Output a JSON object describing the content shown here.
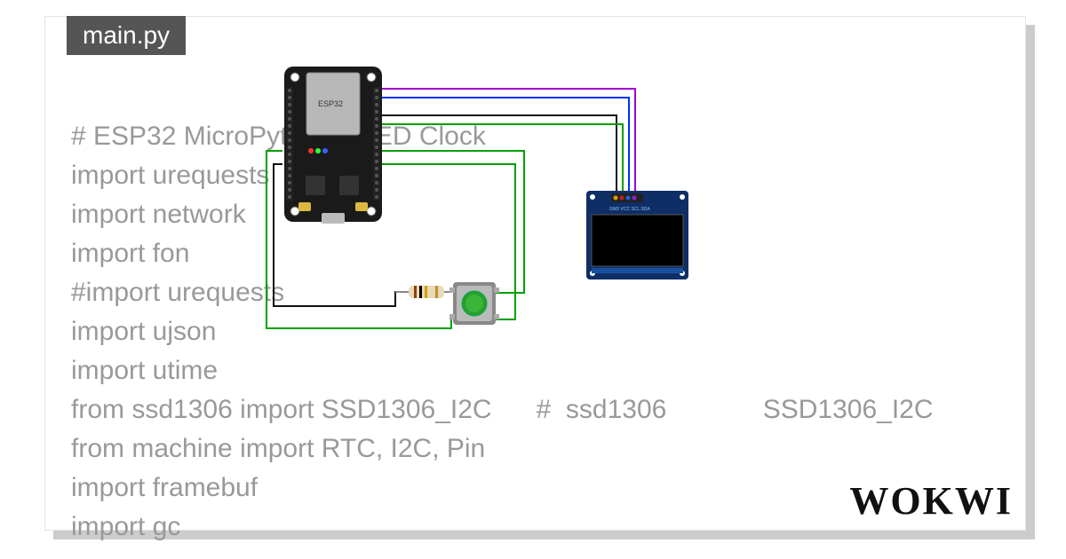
{
  "tab": {
    "title": "main.py"
  },
  "code": {
    "lines": [
      "# ESP32 MicroPython OLED Clock",
      "import urequests",
      "import network",
      "import fon",
      "#import urequests",
      "import ujson",
      "import utime",
      "from ssd1306 import SSD1306_I2C      #  ssd1306             SSD1306_I2C",
      "from machine import RTC, I2C, Pin",
      "import framebuf",
      "import gc"
    ]
  },
  "brand": {
    "logo": "WOKWI"
  },
  "components": {
    "esp32": {
      "label": "ESP32"
    },
    "oled": {
      "pins": "GND VCC SCL SDA"
    },
    "button": {
      "name": "pushbutton"
    },
    "resistor": {
      "name": "resistor"
    }
  },
  "wire_colors": {
    "gnd": "#111111",
    "vcc": "#00a000",
    "sda": "#a000d0",
    "scl": "#0030ff",
    "btn": "#00a000"
  }
}
